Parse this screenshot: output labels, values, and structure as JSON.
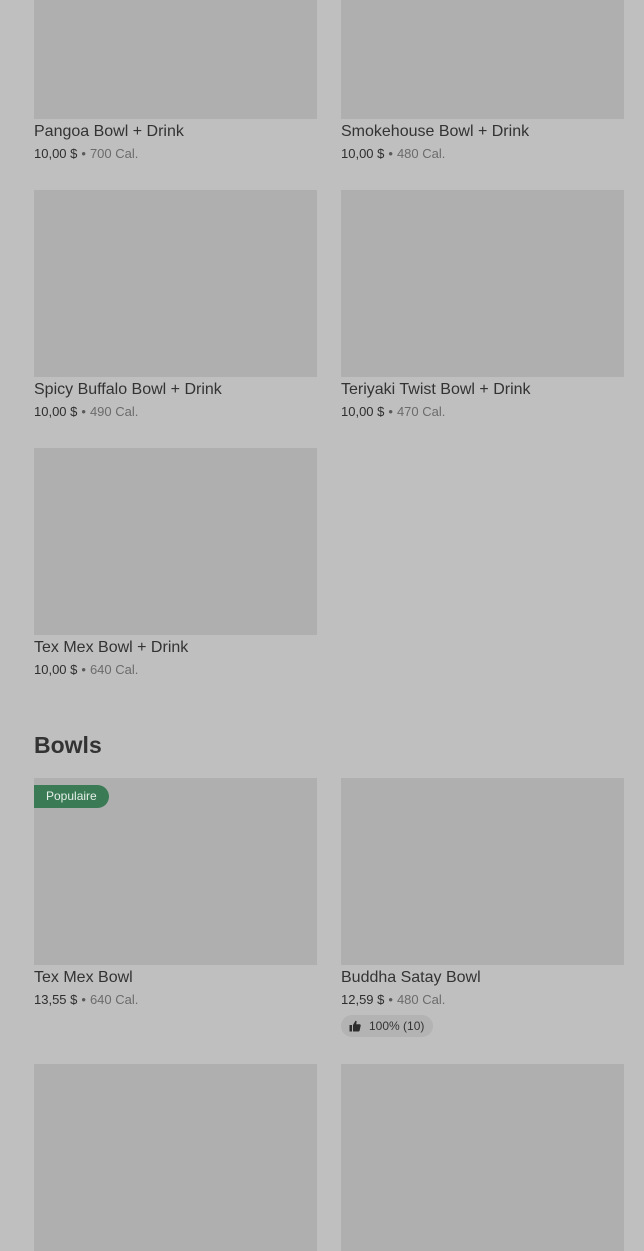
{
  "cards_top": [
    {
      "name": "Pangoa Bowl + Drink",
      "price": "10,00 $",
      "sep": "•",
      "cal": "700 Cal."
    },
    {
      "name": "Smokehouse Bowl + Drink",
      "price": "10,00 $",
      "sep": "•",
      "cal": "480 Cal."
    },
    {
      "name": "Spicy Buffalo Bowl + Drink",
      "price": "10,00 $",
      "sep": "•",
      "cal": "490 Cal."
    },
    {
      "name": "Teriyaki Twist Bowl + Drink",
      "price": "10,00 $",
      "sep": "•",
      "cal": "470 Cal."
    },
    {
      "name": "Tex Mex Bowl + Drink",
      "price": "10,00 $",
      "sep": "•",
      "cal": "640 Cal."
    }
  ],
  "bowls_section": {
    "title": "Bowls",
    "items": [
      {
        "name": "Tex Mex Bowl",
        "price": "13,55 $",
        "sep": "•",
        "cal": "640 Cal.",
        "badge": "Populaire"
      },
      {
        "name": "Buddha Satay Bowl",
        "price": "12,59 $",
        "sep": "•",
        "cal": "480 Cal.",
        "rating": "100% (10)",
        "rating_icon": "thumbs-up-icon"
      }
    ]
  },
  "colors": {
    "background": "#bfbfbf",
    "image_placeholder": "#afafaf",
    "badge": "#3a7a55"
  }
}
